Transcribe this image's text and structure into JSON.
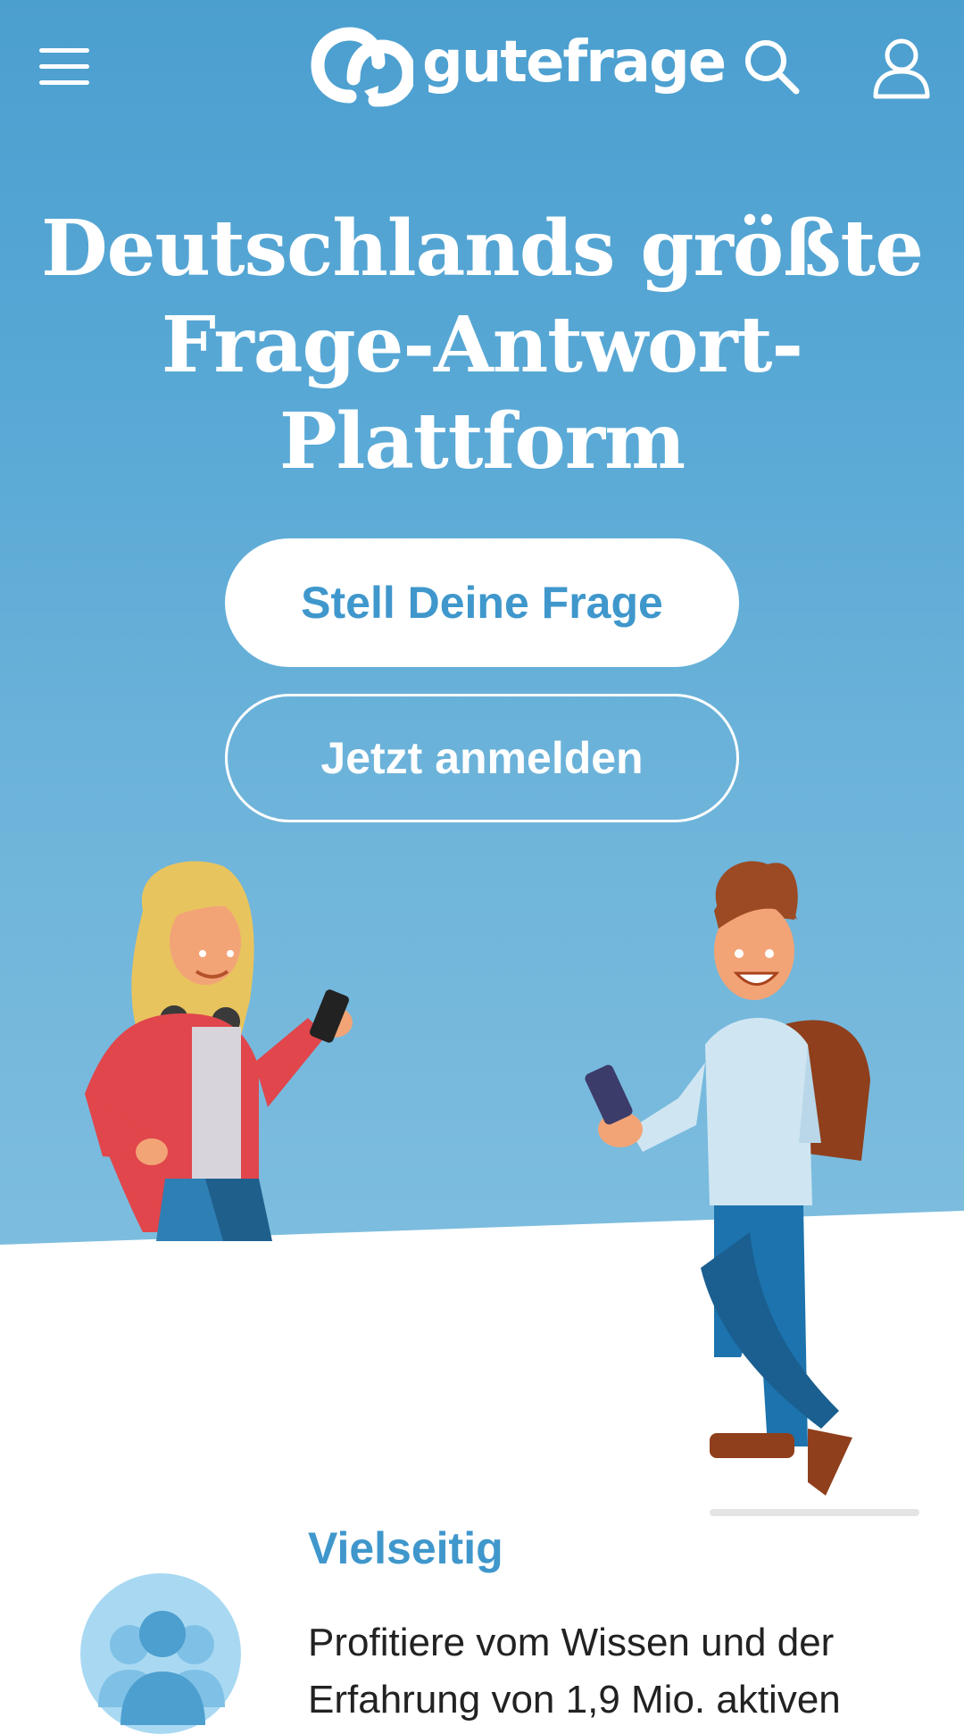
{
  "header": {
    "logo_text": "gutefrage",
    "icons": [
      "menu-icon",
      "gutefrage-logo-icon",
      "search-icon",
      "user-icon"
    ]
  },
  "hero": {
    "title": "Deutschlands größte Frage-Antwort-Plattform",
    "primary_button": "Stell Deine Frage",
    "secondary_button": "Jetzt anmelden"
  },
  "features": {
    "title": "Vielseitig",
    "text": "Profitiere vom Wissen und der Erfahrung von 1,9 Mio. aktiven",
    "icon": "users-group-icon"
  },
  "colors": {
    "hero_blue": "#4b9fcf",
    "accent_blue": "#3f97cc",
    "white": "#ffffff",
    "text": "#222222"
  }
}
